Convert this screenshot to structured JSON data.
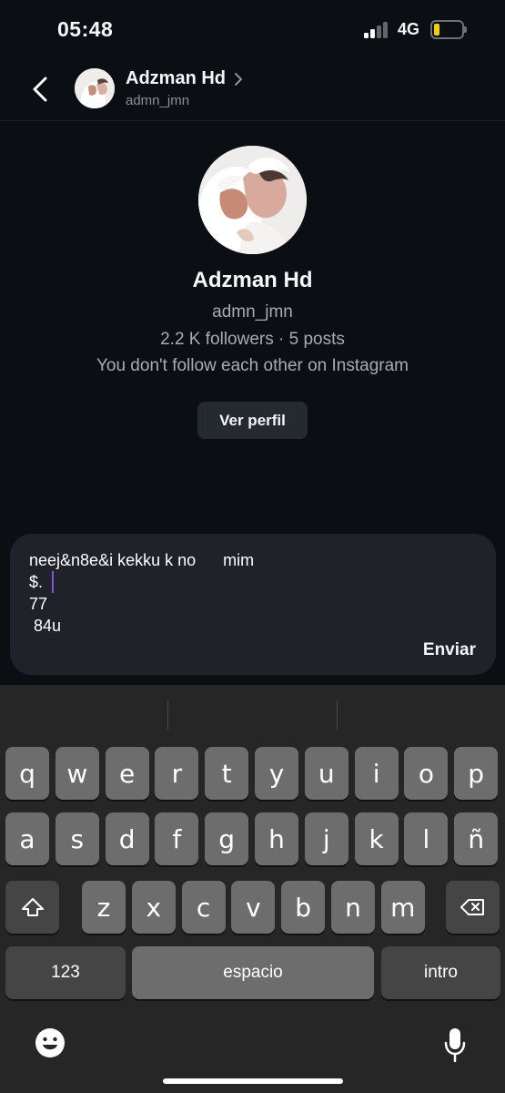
{
  "status_bar": {
    "time": "05:48",
    "network": "4G",
    "signal_bars_active": 2,
    "signal_bars_total": 4,
    "battery_level": 0.22,
    "battery_color": "#f4d000"
  },
  "header": {
    "back_icon": "back-icon",
    "name": "Adzman Hd",
    "username": "admn_jmn",
    "chevron_icon": "chevron-right-icon"
  },
  "profile": {
    "name": "Adzman Hd",
    "username": "admn_jmn",
    "stats": "2.2 K followers · 5 posts",
    "follow_status": "You don't follow each other on Instagram",
    "view_profile_label": "Ver perfil"
  },
  "composer": {
    "lines": [
      "neej&n8e&i kekku k no      mim",
      "$.",
      "77",
      " 84u"
    ],
    "send_label": "Enviar"
  },
  "keyboard": {
    "rows": [
      [
        "q",
        "w",
        "e",
        "r",
        "t",
        "y",
        "u",
        "i",
        "o",
        "p"
      ],
      [
        "a",
        "s",
        "d",
        "f",
        "g",
        "h",
        "j",
        "k",
        "l",
        "ñ"
      ],
      [
        "z",
        "x",
        "c",
        "v",
        "b",
        "n",
        "m"
      ]
    ],
    "numbers_label": "123",
    "space_label": "espacio",
    "return_label": "intro",
    "shift_icon": "shift-icon",
    "delete_icon": "delete-icon",
    "emoji_icon": "emoji-icon",
    "microphone_icon": "microphone-icon"
  },
  "colors": {
    "background": "#0b0f14",
    "composer": "#1f2329",
    "keyboard": "#262626",
    "key": "#6d6d6d",
    "function_key": "#454545",
    "caret": "#8a4ee6"
  }
}
